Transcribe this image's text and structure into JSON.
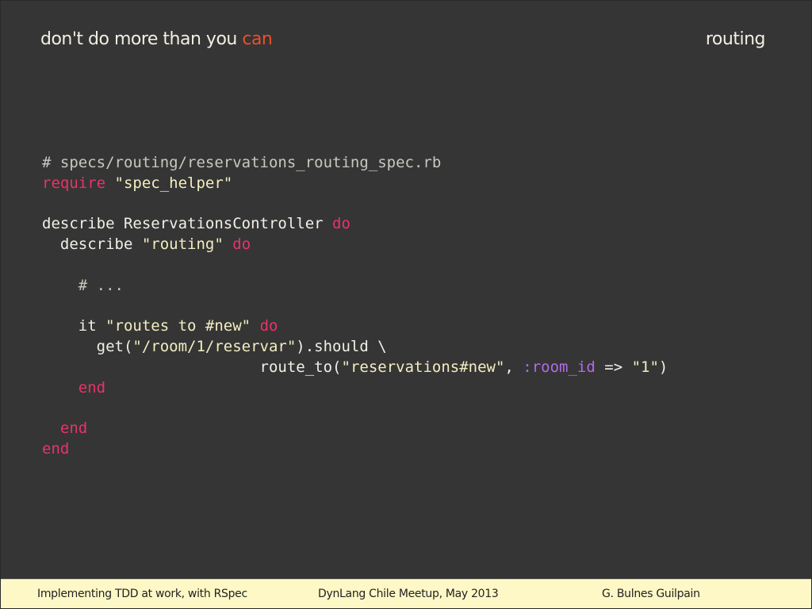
{
  "header": {
    "title_prefix": "don't do more than you ",
    "title_accent": "can",
    "section": "routing"
  },
  "code": {
    "lines": [
      [
        {
          "t": "comment",
          "v": "# specs/routing/reservations_routing_spec.rb"
        }
      ],
      [
        {
          "t": "keyword",
          "v": "require"
        },
        {
          "t": "plain",
          "v": " "
        },
        {
          "t": "string",
          "v": "\"spec_helper\""
        }
      ],
      [],
      [
        {
          "t": "plain",
          "v": "describe ReservationsController "
        },
        {
          "t": "keyword",
          "v": "do"
        }
      ],
      [
        {
          "t": "plain",
          "v": "  describe "
        },
        {
          "t": "string",
          "v": "\"routing\""
        },
        {
          "t": "plain",
          "v": " "
        },
        {
          "t": "keyword",
          "v": "do"
        }
      ],
      [],
      [
        {
          "t": "comment",
          "v": "    # ..."
        }
      ],
      [],
      [
        {
          "t": "plain",
          "v": "    it "
        },
        {
          "t": "string",
          "v": "\"routes to #new\""
        },
        {
          "t": "plain",
          "v": " "
        },
        {
          "t": "keyword",
          "v": "do"
        }
      ],
      [
        {
          "t": "plain",
          "v": "      get("
        },
        {
          "t": "string",
          "v": "\"/room/1/reservar\""
        },
        {
          "t": "plain",
          "v": ").should \\"
        }
      ],
      [
        {
          "t": "plain",
          "v": "                        route_to("
        },
        {
          "t": "string",
          "v": "\"reservations#new\""
        },
        {
          "t": "plain",
          "v": ", "
        },
        {
          "t": "symbol",
          "v": ":room_id"
        },
        {
          "t": "plain",
          "v": " => "
        },
        {
          "t": "string",
          "v": "\"1\""
        },
        {
          "t": "plain",
          "v": ")"
        }
      ],
      [
        {
          "t": "keyword",
          "v": "    end"
        }
      ],
      [],
      [
        {
          "t": "keyword",
          "v": "  end"
        }
      ],
      [
        {
          "t": "keyword",
          "v": "end"
        }
      ]
    ]
  },
  "footer": {
    "left": "Implementing TDD at work, with RSpec",
    "center": "DynLang Chile Meetup, May 2013",
    "right": "G. Bulnes Guilpain"
  },
  "colors": {
    "background": "#353535",
    "accent": "#e8502a",
    "keyword": "#e8336a",
    "string": "#f2eec0",
    "symbol": "#b06ce8",
    "footer_bg": "#fdf8c6"
  }
}
